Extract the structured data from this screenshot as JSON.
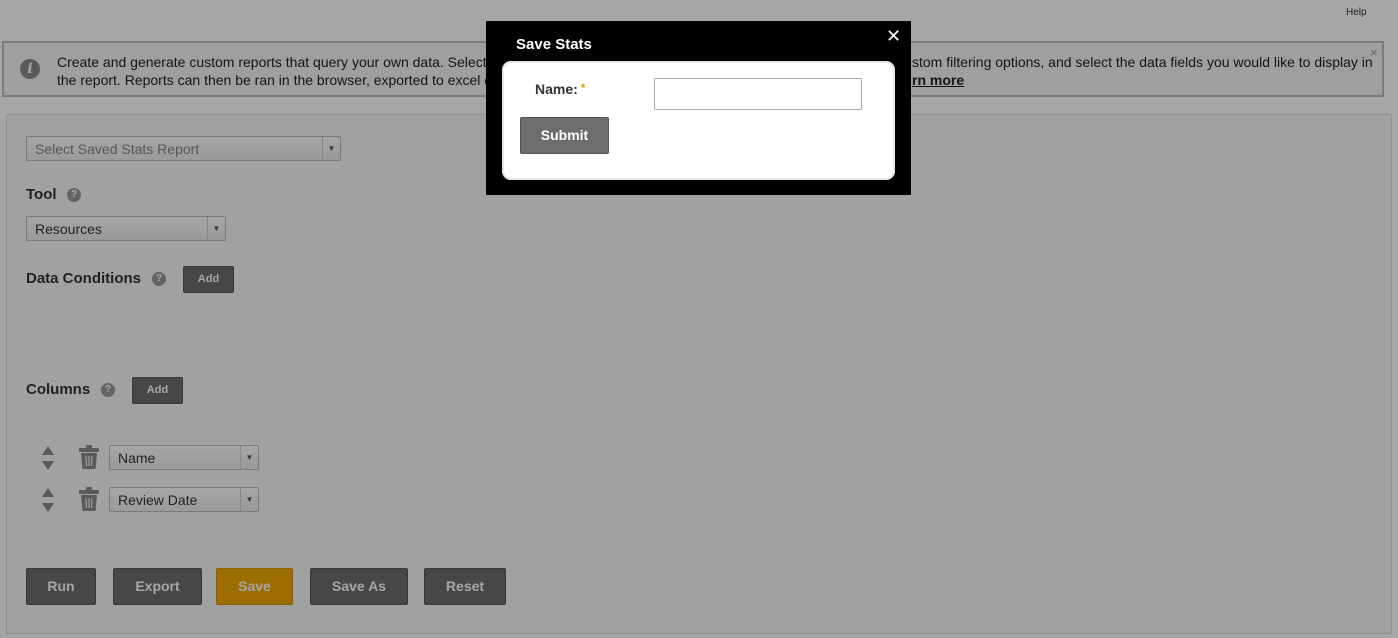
{
  "header": {
    "help_label": "Help"
  },
  "banner": {
    "text_part1": "Create and generate custom reports that query your own data. Select ",
    "text_part2": "",
    "learn_more_label": "rn more",
    "visible_left": "Create and generate custom reports that query your own data. Select",
    "visible_left_line2": "the report. Reports can then be ran in the browser, exported to excel o",
    "visible_right": "stom filtering options, and select the data fields you would like to display in",
    "close_icon": "×"
  },
  "report_select": {
    "placeholder": "Select Saved Stats Report"
  },
  "tool": {
    "label": "Tool",
    "selected": "Resources"
  },
  "data_conditions": {
    "label": "Data Conditions",
    "add_label": "Add"
  },
  "columns": {
    "label": "Columns",
    "add_label": "Add",
    "items": [
      {
        "selected": "Name"
      },
      {
        "selected": "Review Date"
      }
    ]
  },
  "actions": {
    "run": "Run",
    "export": "Export",
    "save": "Save",
    "save_as": "Save As",
    "reset": "Reset"
  },
  "modal": {
    "title": "Save Stats",
    "close_icon": "✕",
    "name_label": "Name:",
    "required_mark": "*",
    "name_value": "",
    "submit_label": "Submit"
  },
  "colors": {
    "accent": "#f0a800",
    "button_gray": "#6d6d6d",
    "modal_bg": "#000000"
  }
}
